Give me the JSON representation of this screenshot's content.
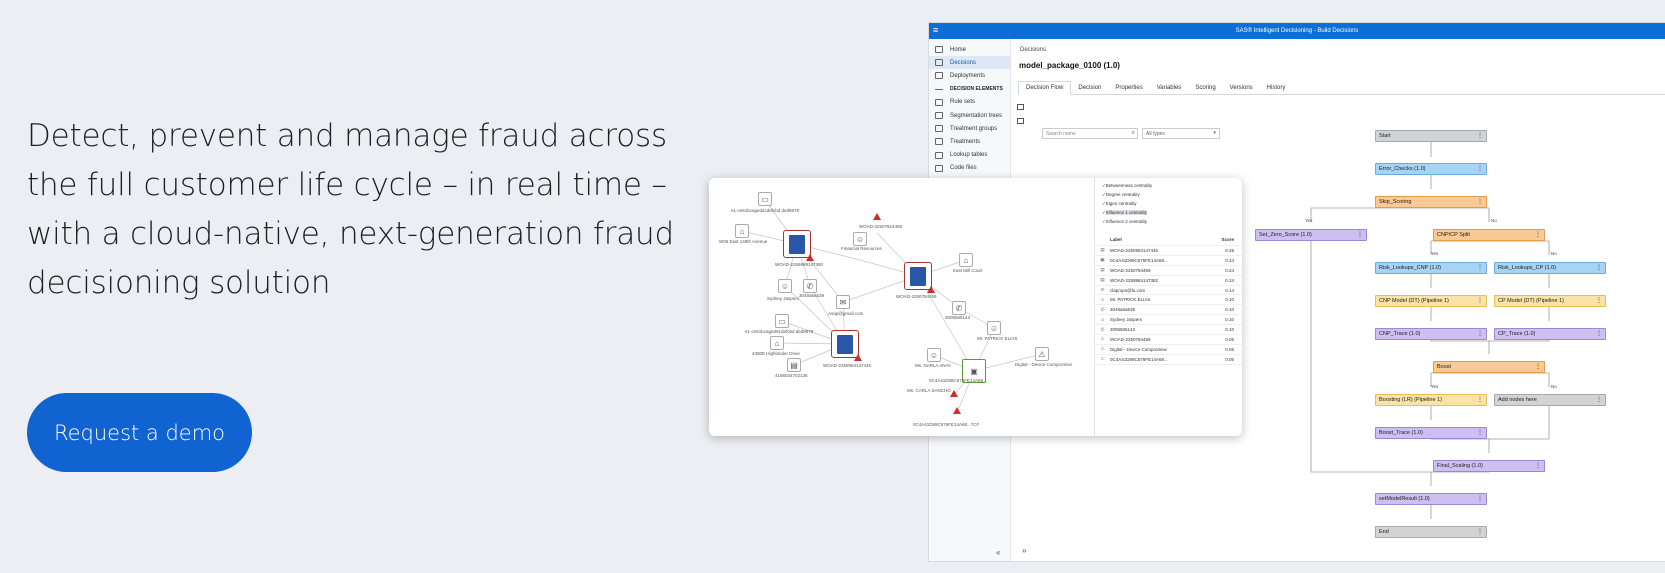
{
  "hero": {
    "headline": "Detect, prevent and manage fraud across the full customer life cycle – in real time – with a cloud-native, next-generation fraud decisioning solution",
    "cta_label": "Request a demo"
  },
  "app": {
    "title": "SAS® Intelligent Decisioning - Build Decisions",
    "nav": [
      {
        "label": "Home"
      },
      {
        "label": "Decisions",
        "active": true
      },
      {
        "label": "Deployments"
      },
      {
        "label": "DECISION ELEMENTS",
        "section": true
      },
      {
        "label": "Rule sets"
      },
      {
        "label": "Segmentation trees"
      },
      {
        "label": "Treatment groups"
      },
      {
        "label": "Treatments"
      },
      {
        "label": "Lookup tables"
      },
      {
        "label": "Code files"
      }
    ],
    "breadcrumb": "Decisions",
    "model_title": "model_package_0100 (1.0)",
    "tabs": [
      "Decision Flow",
      "Decision",
      "Properties",
      "Variables",
      "Scoring",
      "Versions",
      "History"
    ],
    "search_placeholder": "Search name",
    "types_select": "All types",
    "flow_nodes": {
      "start": "Start",
      "error_checks": "Error_Checks (1.0)",
      "skip_scoring": "Skip_Scoring",
      "set_zero_score": "Set_Zero_Score (1.0)",
      "cnp_cp_split": "CNP/CP Split",
      "risk_lookups_cnp": "Risk_Lookups_CNP (1.0)",
      "risk_lookups_cp": "Risk_Lookups_CP (1.0)",
      "cnp_model": "CNP Model (DT) (Pipeline 1)",
      "cp_model": "CP Model (DT) (Pipeline 1)",
      "cnp_trace": "CNP_Trace (1.0)",
      "cp_trace": "CP_Trace (1.0)",
      "boost": "Boost",
      "boosting": "Boosting (LR) (Pipeline 1)",
      "add_nodes": "Add nodes here",
      "boost_trace": "Boost_Trace (1.0)",
      "final_scaling": "Final_Scaling (1.0)",
      "set_model_result": "setModelResult (1.0)",
      "end": "End",
      "yes": "Yes",
      "no": "No"
    }
  },
  "graph": {
    "labels": {
      "l1": "e1-ce51bcaged2cdefcbd ded9879",
      "l2": "W06 East 148th Avenue",
      "l3": "WOAD-2259989147380",
      "l4": "Sydney Jaspers",
      "l5": "3048a6a539",
      "l6": "e1-ce51bcaged91defcbd ded9879",
      "l7": "4390E Highlander Drive",
      "l8": "4166034702136",
      "l9": "WOAD-2259984147445",
      "l10": "WOAD-22507824459",
      "l11": "Financial Resources",
      "l12": "Asap@gmail.com",
      "l13": "WOAD-2250784459",
      "l14": "East Mill Court",
      "l15": "3005565143",
      "l16": "Mr. PATRICK ELIAS",
      "l17": "Ms. NARLA ANAY",
      "l18": "Digital - Device Compromise",
      "l19": "Ms. CARLA SANCHO",
      "l20": "0C4A41D89C576FE14A68...",
      "l21": "0C4A41D89C576FE14A68...7CF"
    },
    "checks": [
      "Betweenness centrality",
      "Degree centrality",
      "Eigen centrality",
      "Influence 1 centrality",
      "Influence 2 centrality"
    ],
    "table_head": {
      "label": "Label",
      "score": "Score"
    },
    "rows": [
      {
        "label": "WOAD-2250984147445",
        "score": "0.25"
      },
      {
        "label": "0C4A41D89C576FE14A68...",
        "score": "0.24"
      },
      {
        "label": "WOAD-2250784459",
        "score": "0.24"
      },
      {
        "label": "WOAD-2259984147382",
        "score": "0.24"
      },
      {
        "label": "claprops@fu.com",
        "score": "0.14"
      },
      {
        "label": "Mr. PATRICK ELIAS",
        "score": "0.10"
      },
      {
        "label": "3048a6a539",
        "score": "0.10"
      },
      {
        "label": "Sydney Jaspers",
        "score": "0.10"
      },
      {
        "label": "3005565143",
        "score": "0.10"
      },
      {
        "label": "WOAD-2250784459",
        "score": "0.05"
      },
      {
        "label": "Digital - Device Compromise",
        "score": "0.05"
      },
      {
        "label": "0C4A41D89C576FE14A68...",
        "score": "0.05"
      }
    ]
  },
  "colors": {
    "accent": "#1063d1",
    "appbar": "#0b6fd6"
  }
}
